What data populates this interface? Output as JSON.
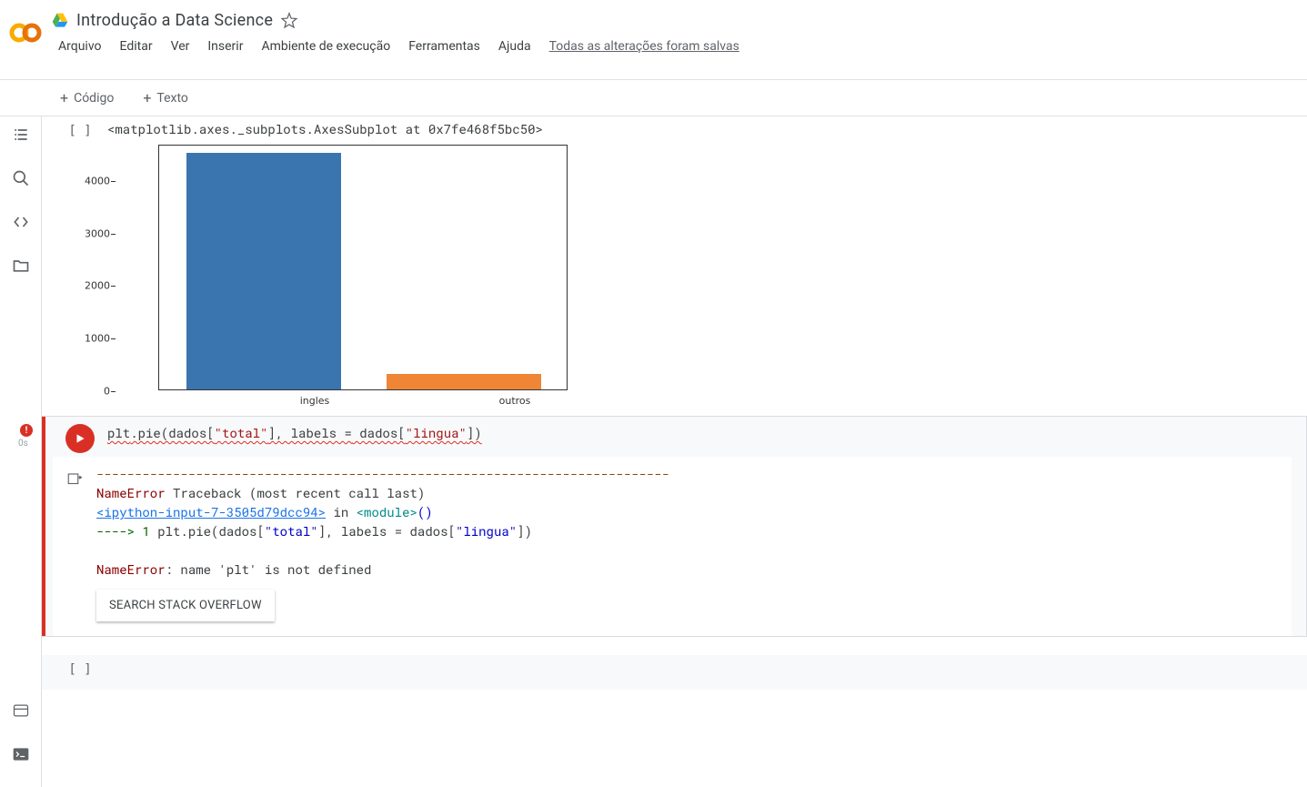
{
  "header": {
    "doc_title": "Introdução a Data Science",
    "menu": {
      "arquivo": "Arquivo",
      "editar": "Editar",
      "ver": "Ver",
      "inserir": "Inserir",
      "ambiente": "Ambiente de execução",
      "ferramentas": "Ferramentas",
      "ajuda": "Ajuda"
    },
    "save_status": "Todas as alterações foram salvas"
  },
  "toolbar": {
    "codigo": "Código",
    "texto": "Texto"
  },
  "cell_output1": {
    "repr": "<matplotlib.axes._subplots.AxesSubplot at 0x7fe468f5bc50>"
  },
  "chart_data": {
    "type": "bar",
    "categories": [
      "ingles",
      "outros"
    ],
    "values": [
      4500,
      300
    ],
    "ylim": [
      0,
      4500
    ],
    "yticks": [
      0,
      1000,
      2000,
      3000,
      4000
    ]
  },
  "cell2": {
    "exec_time": "0s",
    "code_parts": {
      "p1": "plt",
      "p2": ".pie(dados[",
      "p3": "\"total\"",
      "p4": "], labels ",
      "p5": "=",
      "p6": " dados[",
      "p7": "\"lingua\"",
      "p8": "])"
    }
  },
  "traceback": {
    "dashes": "---------------------------------------------------------------------------",
    "err_name": "NameError",
    "tb_header": "                                 Traceback (most recent call last)",
    "ipython_link": "<ipython-input-7-3505d79dcc94>",
    "in_text": " in ",
    "module": "<module>",
    "parens": "()",
    "arrow": "----> 1",
    "code_echo_1": " plt",
    "code_echo_2": ".",
    "code_echo_3": "pie",
    "code_echo_4": "(",
    "code_echo_5": "dados",
    "code_echo_6": "[",
    "code_echo_7": "\"total\"",
    "code_echo_8": "],",
    "code_echo_9": " labels ",
    "code_echo_10": "=",
    "code_echo_11": " dados",
    "code_echo_12": "[",
    "code_echo_13": "\"lingua\"",
    "code_echo_14": "])",
    "final_err": "NameError",
    "final_msg": ": name 'plt' is not defined"
  },
  "so_button": "SEARCH STACK OVERFLOW"
}
